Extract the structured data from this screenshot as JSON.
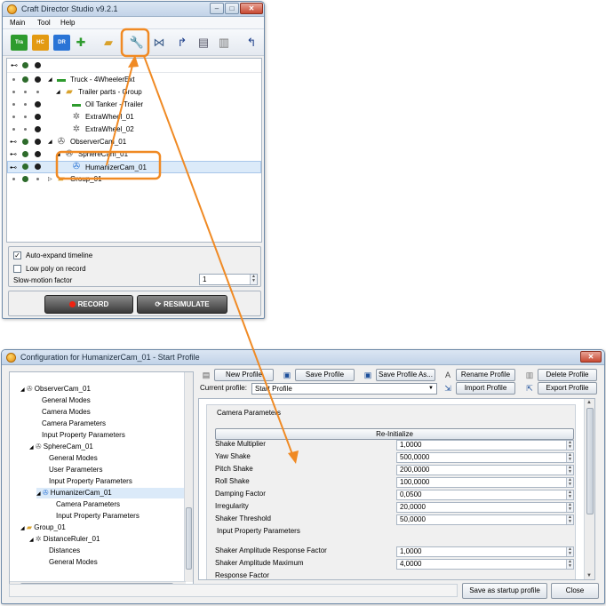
{
  "main_window": {
    "title": "Craft Director Studio v9.2.1",
    "menu": [
      "Main",
      "Tool",
      "Help"
    ],
    "toolbar_buttons": [
      {
        "label": "Tra",
        "color": "#2e9b2e"
      },
      {
        "label": "HC",
        "color": "#e39a12"
      },
      {
        "label": "DR",
        "color": "#2a74d6"
      }
    ],
    "tree": [
      {
        "label": "Truck - 4WheelerExt",
        "icon": "truck-icon"
      },
      {
        "label": "Trailer parts - Group",
        "icon": "folder-icon"
      },
      {
        "label": "Oil Tanker - Trailer",
        "icon": "truck-icon"
      },
      {
        "label": "ExtraWheel_01",
        "icon": "gear-icon"
      },
      {
        "label": "ExtraWheel_02",
        "icon": "gear-icon"
      },
      {
        "label": "ObserverCam_01",
        "icon": "camera-icon"
      },
      {
        "label": "SphereCam_01",
        "icon": "camera-icon"
      },
      {
        "label": "HumanizerCam_01",
        "icon": "camera-icon"
      },
      {
        "label": "Group_01",
        "icon": "folder-icon"
      }
    ],
    "options": {
      "auto_expand": "Auto-expand timeline",
      "low_poly": "Low poly on record",
      "slowmo_label": "Slow-motion factor",
      "slowmo_value": "1"
    },
    "record_label": "RECORD",
    "resimulate_label": "RESIMULATE"
  },
  "config_window": {
    "title": "Configuration for HumanizerCam_01 - Start Profile",
    "left_tree": [
      "ObserverCam_01",
      "General Modes",
      "Camera Modes",
      "Camera Parameters",
      "Input Property Parameters",
      "SphereCam_01",
      "General Modes",
      "User Parameters",
      "Input Property Parameters",
      "HumanizerCam_01",
      "Camera Parameters",
      "Input Property Parameters",
      "Group_01",
      "DistanceRuler_01",
      "Distances",
      "General Modes"
    ],
    "buttons": {
      "new_profile": "New Profile",
      "save_profile": "Save Profile",
      "save_profile_as": "Save Profile As...",
      "rename_profile": "Rename Profile",
      "delete_profile": "Delete Profile",
      "import_profile": "Import Profile",
      "export_profile": "Export Profile",
      "reinitialize": "Re-Initialize",
      "save_startup": "Save as startup profile",
      "close": "Close"
    },
    "current_profile_label": "Current profile:",
    "current_profile_value": "Start Profile",
    "camera_params_header": "Camera Parameters",
    "params": [
      {
        "name": "Shake Multiplier",
        "value": "1,0000"
      },
      {
        "name": "Yaw Shake",
        "value": "500,0000"
      },
      {
        "name": "Pitch Shake",
        "value": "200,0000"
      },
      {
        "name": "Roll Shake",
        "value": "100,0000"
      },
      {
        "name": "Damping Factor",
        "value": "0,0500"
      },
      {
        "name": "Irregularity",
        "value": "20,0000"
      },
      {
        "name": "Shaker Threshold",
        "value": "50,0000"
      }
    ],
    "input_params_header": "Input Property Parameters",
    "input_params": [
      {
        "name": "Shaker Amplitude Response Factor",
        "value": "1,0000"
      },
      {
        "name": "Shaker Amplitude Maximum",
        "value": "4,0000"
      },
      {
        "name": "Response Factor",
        "value": ""
      }
    ]
  },
  "colors": {
    "highlight": "#f08a24",
    "selection": "#dbeaf9"
  }
}
